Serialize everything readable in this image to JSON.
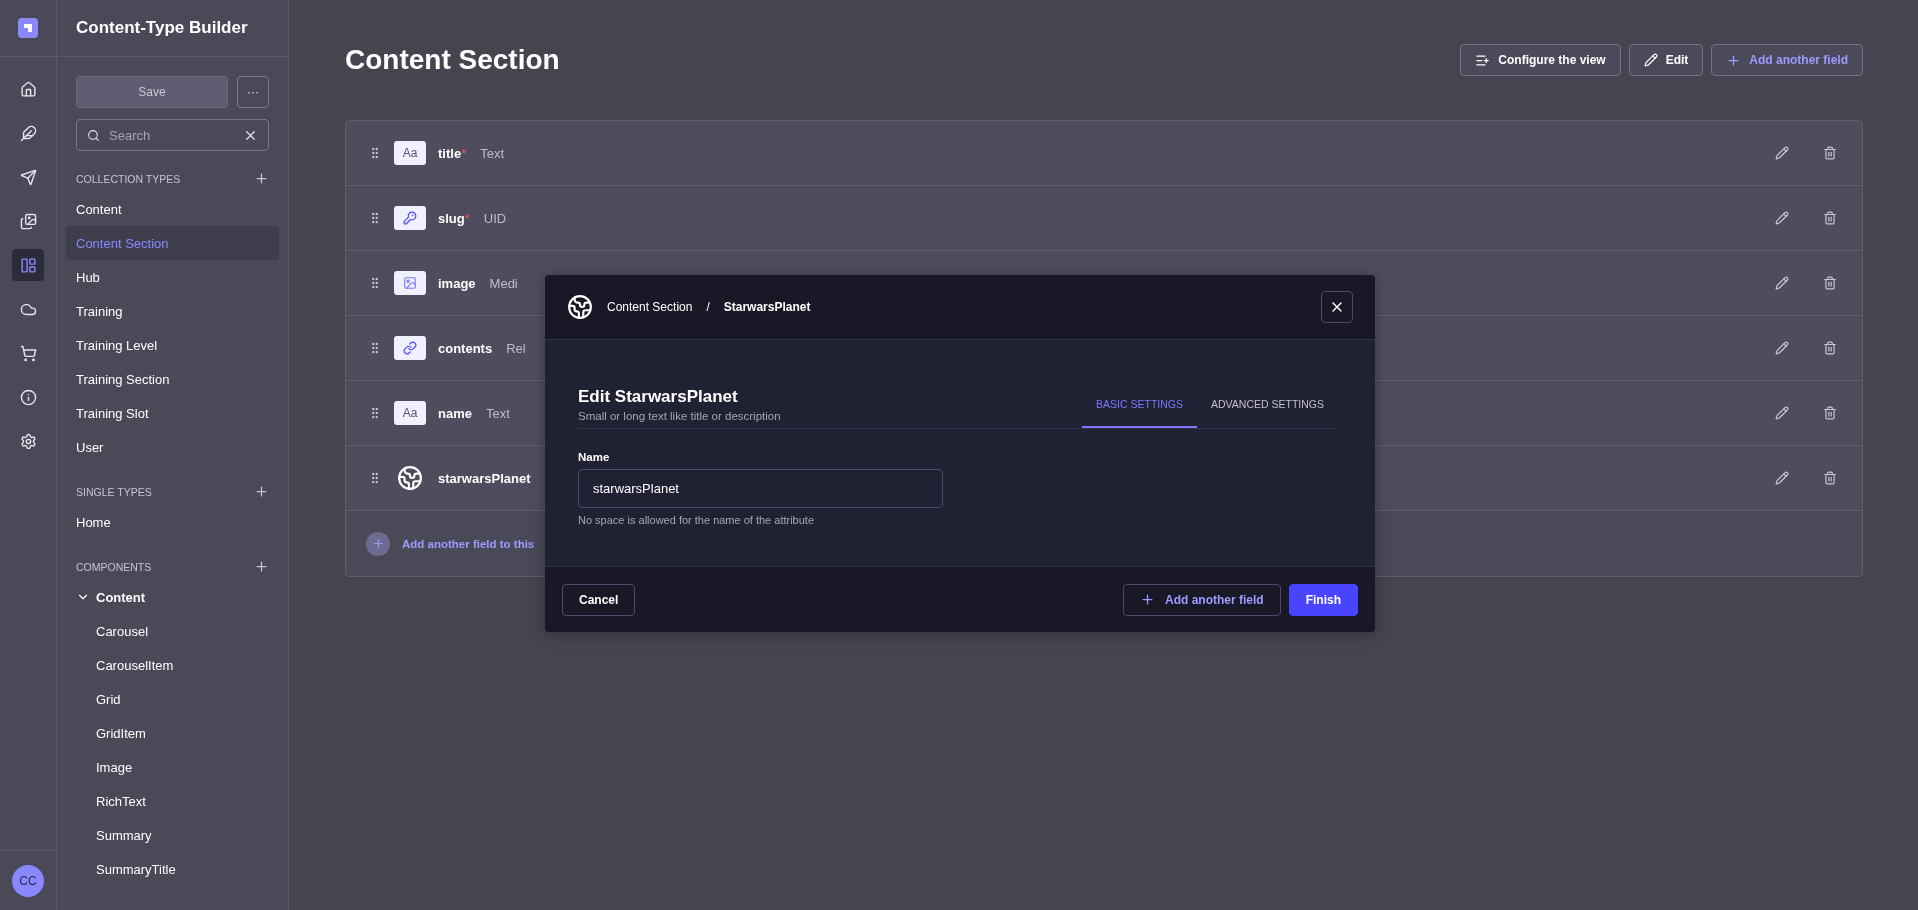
{
  "nav_rail": {
    "items": [
      {
        "kind": "home",
        "selected": false
      },
      {
        "kind": "feather",
        "selected": false
      },
      {
        "kind": "send",
        "selected": false
      },
      {
        "kind": "images",
        "selected": false
      },
      {
        "kind": "layout",
        "selected": true
      },
      {
        "kind": "cloud",
        "selected": false
      },
      {
        "kind": "cart",
        "selected": false
      },
      {
        "kind": "info",
        "selected": false
      },
      {
        "kind": "settings",
        "selected": false
      }
    ],
    "avatar": "CC"
  },
  "sidebar": {
    "title": "Content-Type Builder",
    "save_button": "Save",
    "more_button": "···",
    "search": {
      "placeholder": "Search"
    },
    "sections": [
      {
        "title": "COLLECTION TYPES",
        "items": [
          {
            "label": "Content",
            "selected": false
          },
          {
            "label": "Content Section",
            "selected": true
          },
          {
            "label": "Hub",
            "selected": false
          },
          {
            "label": "Training",
            "selected": false
          },
          {
            "label": "Training Level",
            "selected": false
          },
          {
            "label": "Training Section",
            "selected": false
          },
          {
            "label": "Training Slot",
            "selected": false
          },
          {
            "label": "User",
            "selected": false
          }
        ]
      },
      {
        "title": "SINGLE TYPES",
        "items": [
          {
            "label": "Home",
            "selected": false
          }
        ]
      },
      {
        "title": "COMPONENTS",
        "items": [
          {
            "label": "Content",
            "selected": false,
            "expanded": true,
            "children": [
              {
                "label": "Carousel",
                "selected": false
              },
              {
                "label": "CarouselItem",
                "selected": false
              },
              {
                "label": "Grid",
                "selected": false
              },
              {
                "label": "GridItem",
                "selected": false
              },
              {
                "label": "Image",
                "selected": false
              },
              {
                "label": "RichText",
                "selected": false
              },
              {
                "label": "Summary",
                "selected": false
              },
              {
                "label": "SummaryTitle",
                "selected": false
              }
            ]
          }
        ]
      }
    ]
  },
  "header": {
    "title": "Content Section",
    "buttons": [
      {
        "kind": "configure",
        "label": "Configure the view"
      },
      {
        "kind": "edit",
        "label": "Edit"
      },
      {
        "kind": "add",
        "label": "Add another field"
      }
    ]
  },
  "fields": [
    {
      "kind": "text",
      "badge": "Aa",
      "name": "title",
      "required": true,
      "type": "Text"
    },
    {
      "kind": "uid",
      "name": "slug",
      "required": true,
      "type": "UID"
    },
    {
      "kind": "media",
      "name": "image",
      "required": false,
      "type": "Medi"
    },
    {
      "kind": "relation",
      "name": "contents",
      "required": false,
      "type": "Rel"
    },
    {
      "kind": "text",
      "badge": "Aa",
      "name": "name",
      "required": false,
      "type": "Text"
    },
    {
      "kind": "custom",
      "name": "starwarsPlanet",
      "required": false
    }
  ],
  "required_mark": "*",
  "add_field_link": "Add another field to this",
  "modal": {
    "breadcrumb": [
      "Content Section",
      "StarwarsPlanet"
    ],
    "separator": "/",
    "title": "Edit StarwarsPlanet",
    "subtitle": "Small or long text like title or description",
    "tabs": [
      {
        "label": "BASIC SETTINGS",
        "selected": true
      },
      {
        "label": "ADVANCED SETTINGS",
        "selected": false
      }
    ],
    "name_field": {
      "label": "Name",
      "value": "starwarsPlanet",
      "hint": "No space is allowed for the name of the attribute"
    },
    "cancel": "Cancel",
    "add_another": "Add another field",
    "finish": "Finish"
  }
}
